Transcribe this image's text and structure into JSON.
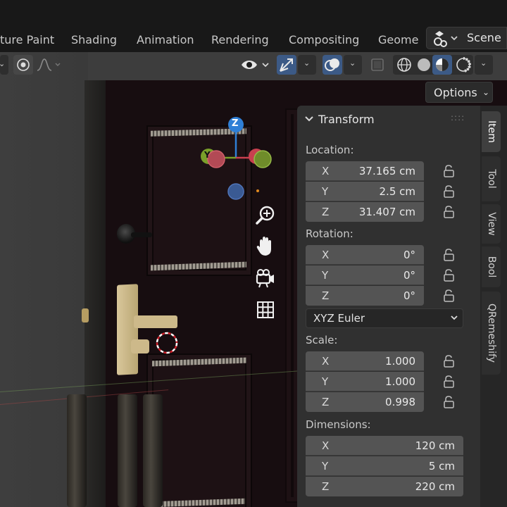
{
  "workspace_tabs": [
    "ture Paint",
    "Shading",
    "Animation",
    "Rendering",
    "Compositing",
    "Geome"
  ],
  "scene": {
    "label": "Scene"
  },
  "options": {
    "label": "Options"
  },
  "gizmo": {
    "z_label": "Z",
    "y_label": "Y"
  },
  "panel": {
    "title": "Transform",
    "location_label": "Location:",
    "location": [
      {
        "axis": "X",
        "value": "37.165 cm"
      },
      {
        "axis": "Y",
        "value": "2.5 cm"
      },
      {
        "axis": "Z",
        "value": "31.407 cm"
      }
    ],
    "rotation_label": "Rotation:",
    "rotation": [
      {
        "axis": "X",
        "value": "0°"
      },
      {
        "axis": "Y",
        "value": "0°"
      },
      {
        "axis": "Z",
        "value": "0°"
      }
    ],
    "rotation_mode": "XYZ Euler",
    "scale_label": "Scale:",
    "scale": [
      {
        "axis": "X",
        "value": "1.000"
      },
      {
        "axis": "Y",
        "value": "1.000"
      },
      {
        "axis": "Z",
        "value": "0.998"
      }
    ],
    "dimensions_label": "Dimensions:",
    "dimensions": [
      {
        "axis": "X",
        "value": "120 cm"
      },
      {
        "axis": "Y",
        "value": "5 cm"
      },
      {
        "axis": "Z",
        "value": "220 cm"
      }
    ]
  },
  "sidebar_tabs": [
    "Item",
    "Tool",
    "View",
    "Bool",
    "QRemeshify"
  ],
  "colors": {
    "accent": "#3c5a86",
    "axis_x": "#c8404f",
    "axis_y": "#7aa02a",
    "axis_z": "#2f7fd6"
  }
}
